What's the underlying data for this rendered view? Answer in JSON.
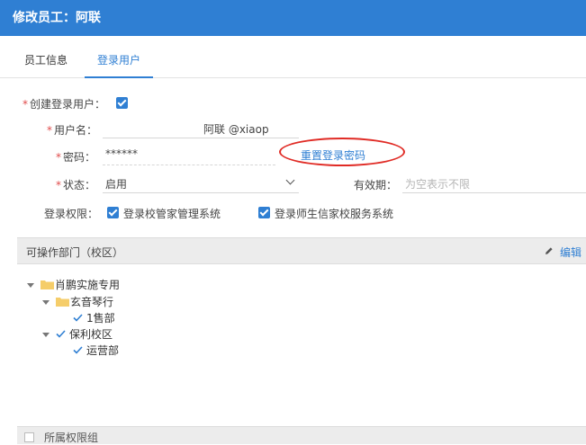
{
  "dialog": {
    "title": "修改员工：阿联"
  },
  "tabs": [
    {
      "label": "员工信息",
      "active": false
    },
    {
      "label": "登录用户",
      "active": true
    }
  ],
  "form": {
    "create_login_user": {
      "label": "创建登录用户：",
      "checked": true
    },
    "username": {
      "label": "用户名：",
      "value": "阿联 @xiaop"
    },
    "password": {
      "label": "密码：",
      "value": "******",
      "reset_link": "重置登录密码"
    },
    "status": {
      "label": "状态：",
      "value": "启用"
    },
    "validity": {
      "label": "有效期：",
      "placeholder": "为空表示不限"
    },
    "login_permission": {
      "label": "登录权限：",
      "options": [
        {
          "label": "登录校管家管理系统",
          "checked": true
        },
        {
          "label": "登录师生信家校服务系统",
          "checked": true
        }
      ]
    }
  },
  "departments": {
    "title": "可操作部门（校区）",
    "edit_label": "编辑",
    "tree": [
      {
        "label": "肖鹏实施专用",
        "type": "folder",
        "expanded": true
      },
      {
        "label": "玄音琴行",
        "type": "folder",
        "expanded": true
      },
      {
        "label": "1售部",
        "type": "checked"
      },
      {
        "label": "保利校区",
        "type": "checked",
        "expanded": true
      },
      {
        "label": "运营部",
        "type": "checked"
      }
    ]
  },
  "bottom_section": {
    "title": "所属权限组"
  },
  "colors": {
    "primary": "#2f7fd3",
    "required": "#e14b4b",
    "highlight": "#e02b25",
    "folder": "#f5cd6a"
  }
}
